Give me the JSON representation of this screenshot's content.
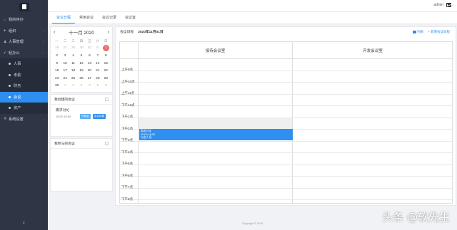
{
  "sidebar": {
    "items": [
      {
        "label": "我的待办",
        "icon": "home-icon"
      },
      {
        "label": "组织",
        "icon": "user-icon"
      },
      {
        "label": "人事管理",
        "icon": "person-icon"
      },
      {
        "label": "轻办公",
        "icon": "rocket-icon"
      }
    ],
    "sub_items": [
      "人事",
      "考勤",
      "财务",
      "会议",
      "资产"
    ],
    "after_items": [
      {
        "label": "系统设置",
        "icon": "gear-icon"
      }
    ],
    "collapse_label": "‹"
  },
  "topbar": {
    "user": "admin"
  },
  "tabs": [
    "会议日程",
    "常用会议",
    "会议记录",
    "会议室"
  ],
  "calendar": {
    "title": "十一月 2020",
    "weekdays": [
      "一",
      "二",
      "三",
      "四",
      "五",
      "六",
      "日"
    ],
    "days": [
      [
        "26",
        "27",
        "28",
        "29",
        "30",
        "31",
        "1"
      ],
      [
        "2",
        "3",
        "4",
        "5",
        "6",
        "7",
        "8"
      ],
      [
        "9",
        "10",
        "11",
        "12",
        "13",
        "14",
        "15"
      ],
      [
        "16",
        "17",
        "18",
        "19",
        "20",
        "21",
        "22"
      ],
      [
        "23",
        "24",
        "25",
        "26",
        "27",
        "28",
        "29"
      ],
      [
        "30",
        "1",
        "2",
        "3",
        "4",
        "5",
        "6"
      ]
    ]
  },
  "my_meetings": {
    "title": "我创建的会议",
    "items": [
      {
        "name": "需求讨论",
        "time": "15:00-16:00",
        "btn_start": "开始会",
        "btn_note": "会议纪要"
      }
    ]
  },
  "joined_meetings": {
    "title": "我参与的会议"
  },
  "schedule": {
    "label": "会议日程",
    "date": "2020年11月01日",
    "list_label": "列表",
    "new_label": "+ 新增会议日程",
    "rooms": [
      "接待会议室",
      "开发会议室"
    ],
    "times": [
      "上午9点",
      "上午10点",
      "上午11点",
      "下午12点",
      "下午1点",
      "下午2点",
      "下午3点",
      "下午4点",
      "下午5点",
      "下午6点",
      "下午7点",
      "下午8点"
    ],
    "event": {
      "title": "需求讨论",
      "time": "15:00-16:00",
      "people": "与会人员:"
    }
  },
  "footer": "Copyright © 2018",
  "watermark": "头条 @软先生"
}
